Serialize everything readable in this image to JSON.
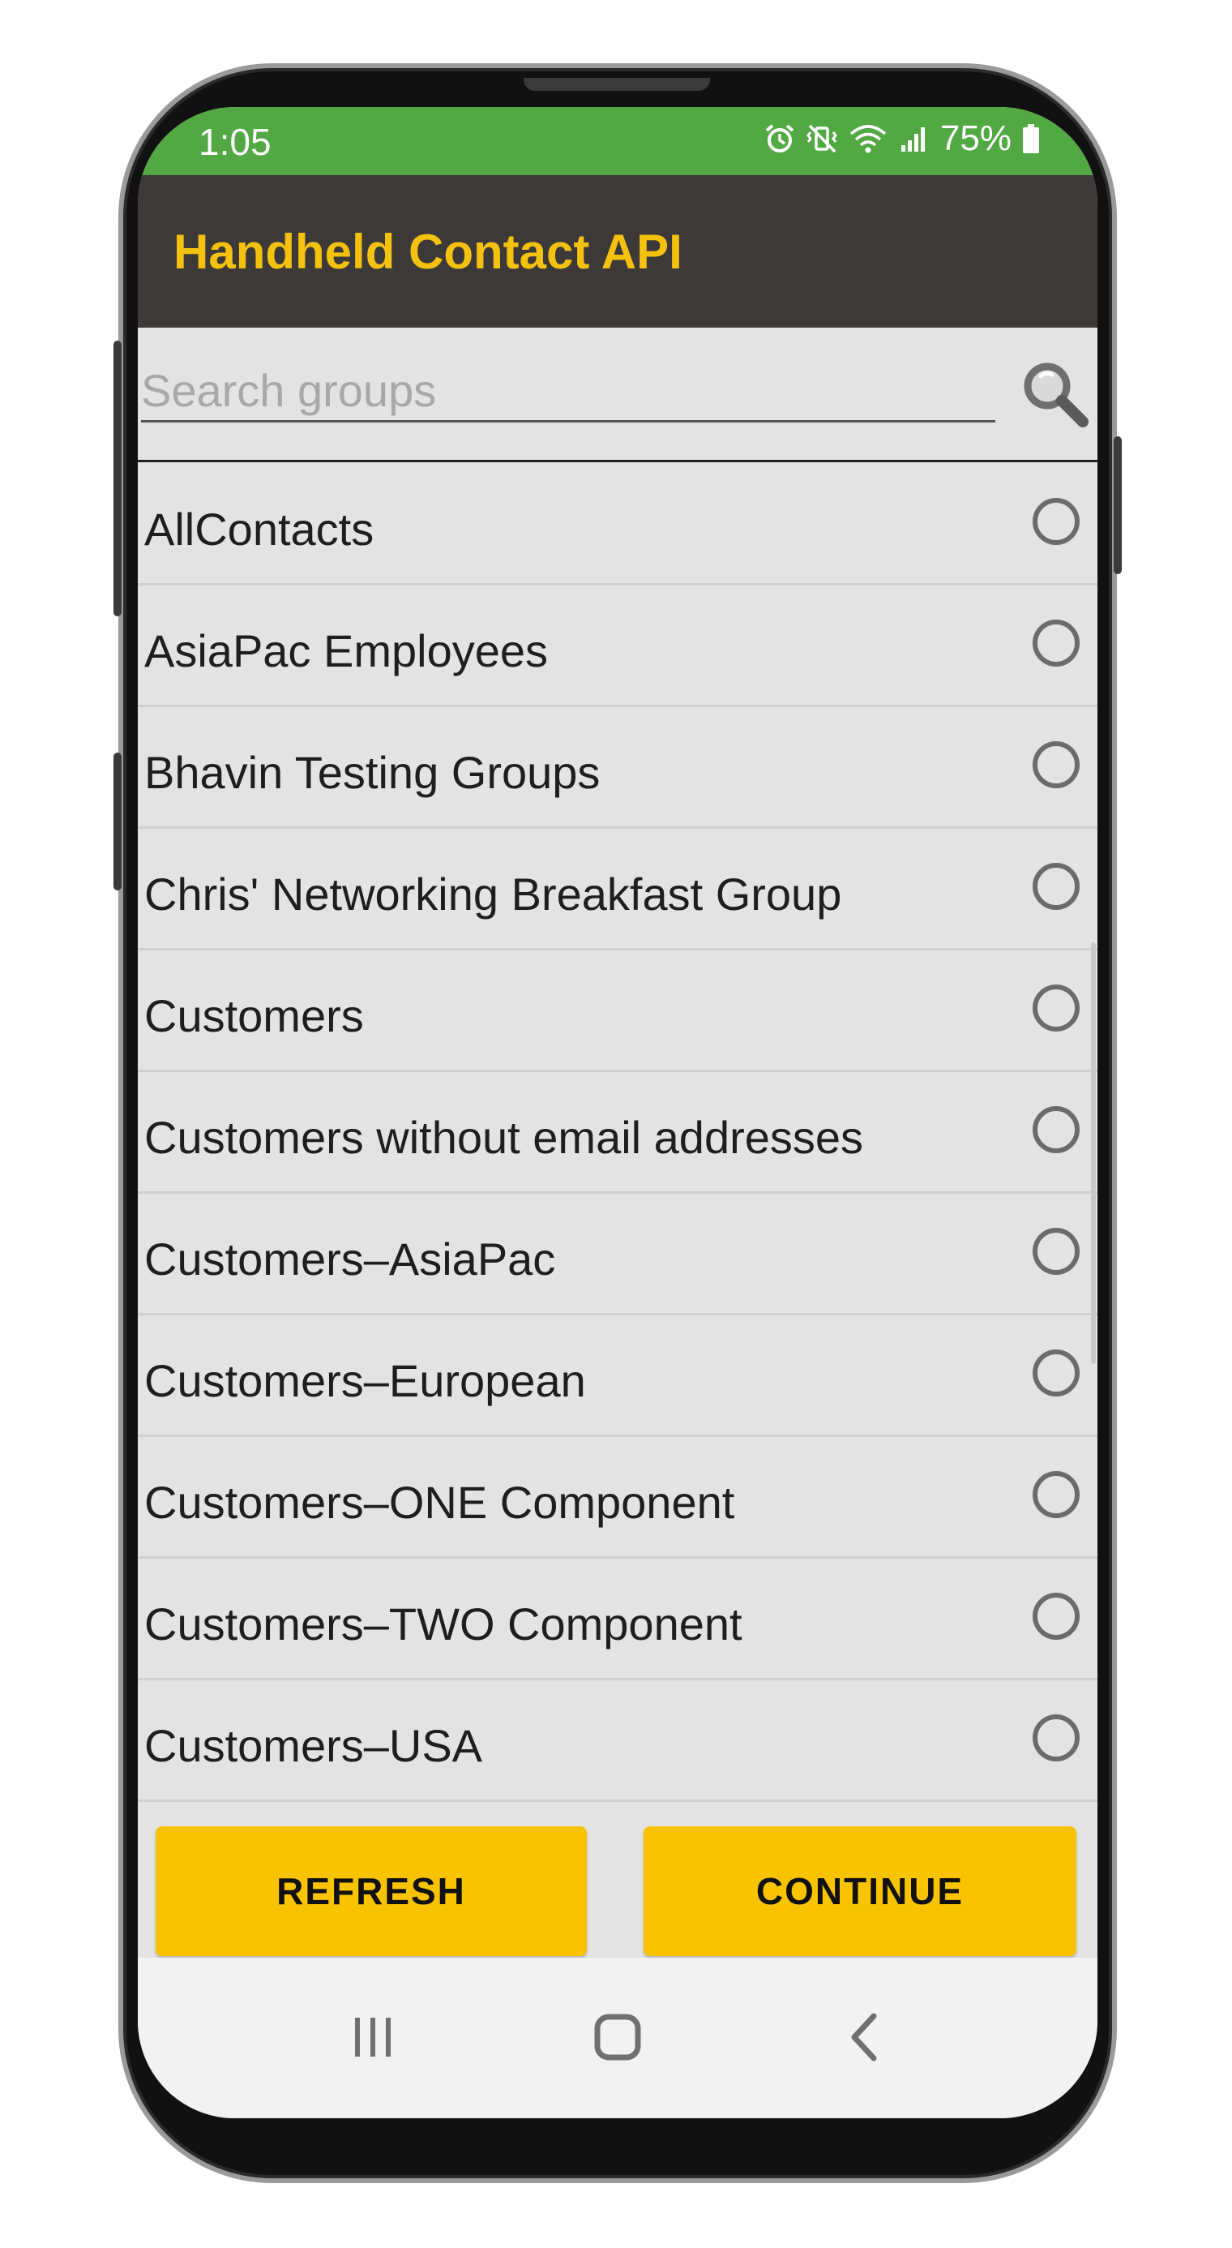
{
  "status_bar": {
    "time": "1:05",
    "battery": "75%",
    "icons": [
      "alarm-icon",
      "vibrate-mute-icon",
      "wifi-icon",
      "signal-icon",
      "battery-icon"
    ]
  },
  "app_bar": {
    "title": "Handheld Contact API"
  },
  "search": {
    "placeholder": "Search groups",
    "value": "",
    "icon": "search-icon"
  },
  "groups": [
    {
      "label": "AllContacts",
      "selected": false
    },
    {
      "label": "AsiaPac Employees",
      "selected": false
    },
    {
      "label": "Bhavin Testing Groups",
      "selected": false
    },
    {
      "label": "Chris' Networking Breakfast Group",
      "selected": false
    },
    {
      "label": "Customers",
      "selected": false
    },
    {
      "label": "Customers without email addresses",
      "selected": false
    },
    {
      "label": "Customers–AsiaPac",
      "selected": false
    },
    {
      "label": "Customers–European",
      "selected": false
    },
    {
      "label": "Customers–ONE Component",
      "selected": false
    },
    {
      "label": "Customers–TWO Component",
      "selected": false
    },
    {
      "label": "Customers–USA",
      "selected": false
    },
    {
      "label": "",
      "selected": false
    }
  ],
  "buttons": {
    "refresh": "REFRESH",
    "continue": "CONTINUE"
  },
  "nav": {
    "icons": [
      "recent-apps-icon",
      "home-icon",
      "back-icon"
    ]
  },
  "colors": {
    "status_bar": "#52a843",
    "app_bar": "#3c3938",
    "title": "#f4c20d",
    "button": "#f9c300",
    "list_bg": "#e3e3e3"
  }
}
